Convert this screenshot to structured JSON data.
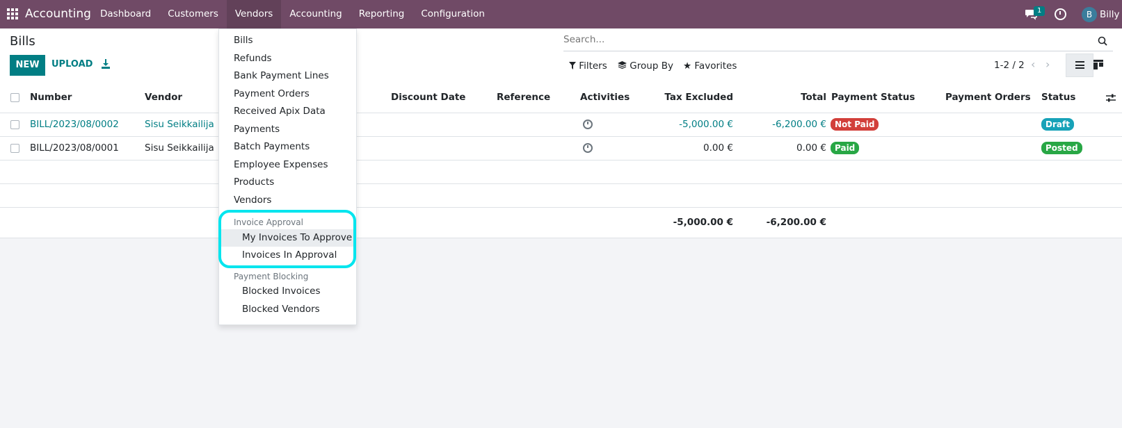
{
  "topbar": {
    "brand": "Accounting",
    "menu": [
      "Dashboard",
      "Customers",
      "Vendors",
      "Accounting",
      "Reporting",
      "Configuration"
    ],
    "chat_count": "1",
    "avatar_letter": "B",
    "username": "Billy"
  },
  "control": {
    "title": "Bills",
    "new_label": "NEW",
    "upload_label": "UPLOAD",
    "search_placeholder": "Search...",
    "filters": "Filters",
    "group_by": "Group By",
    "favorites": "Favorites",
    "pager": "1-2 / 2"
  },
  "table": {
    "headers": {
      "number": "Number",
      "vendor": "Vendor",
      "discount_date": "Discount Date",
      "reference": "Reference",
      "activities": "Activities",
      "tax_excluded": "Tax Excluded",
      "total": "Total",
      "payment_status": "Payment Status",
      "payment_orders": "Payment Orders",
      "status": "Status"
    },
    "rows": [
      {
        "number": "BILL/2023/08/0002",
        "vendor": "Sisu Seikkailija",
        "tax_excluded": "-5,000.00 €",
        "total": "-6,200.00 €",
        "payment_status": "Not Paid",
        "status": "Draft"
      },
      {
        "number": "BILL/2023/08/0001",
        "vendor": "Sisu Seikkailija",
        "tax_excluded": "0.00 €",
        "total": "0.00 €",
        "payment_status": "Paid",
        "status": "Posted"
      }
    ],
    "totals": {
      "tax_excluded": "-5,000.00 €",
      "total": "-6,200.00 €"
    }
  },
  "dropdown": {
    "items": [
      "Bills",
      "Refunds",
      "Bank Payment Lines",
      "Payment Orders",
      "Received Apix Data",
      "Payments",
      "Batch Payments",
      "Employee Expenses",
      "Products",
      "Vendors"
    ],
    "section1_header": "Invoice Approval",
    "section1_items": [
      "My Invoices To Approve",
      "Invoices In Approval"
    ],
    "section2_header": "Payment Blocking",
    "section2_items": [
      "Blocked Invoices",
      "Blocked Vendors"
    ]
  },
  "colors": {
    "topbar": "#704a66",
    "primary": "#017e84",
    "highlight": "#00e5ee"
  }
}
